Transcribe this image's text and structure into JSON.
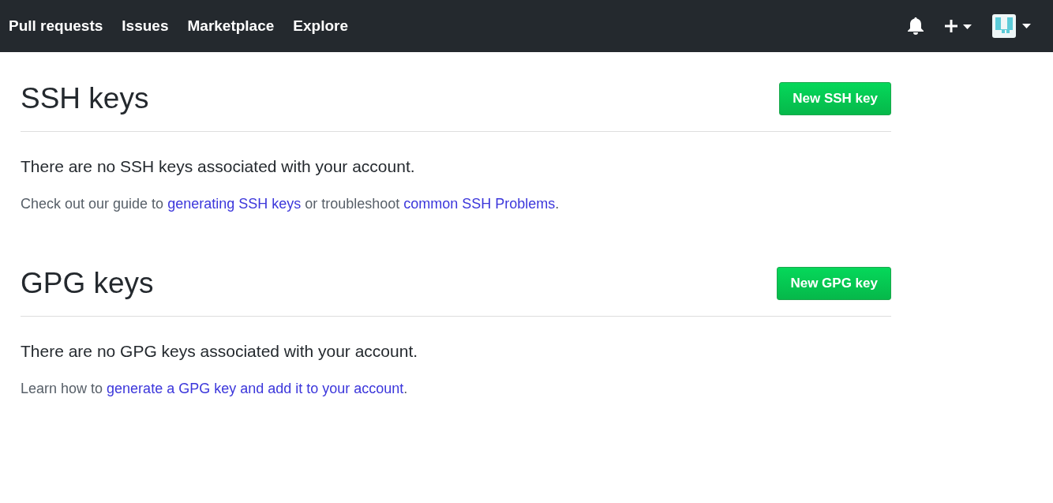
{
  "nav": {
    "links": [
      "Pull requests",
      "Issues",
      "Marketplace",
      "Explore"
    ]
  },
  "sections": [
    {
      "title": "SSH keys",
      "button": "New SSH key",
      "empty": "There are no SSH keys associated with your account.",
      "help": [
        {
          "kind": "text",
          "text": "Check out our guide to "
        },
        {
          "kind": "link",
          "text": "generating SSH keys"
        },
        {
          "kind": "text",
          "text": " or troubleshoot "
        },
        {
          "kind": "link",
          "text": "common SSH Problems"
        },
        {
          "kind": "text",
          "text": "."
        }
      ]
    },
    {
      "title": "GPG keys",
      "button": "New GPG key",
      "empty": "There are no GPG keys associated with your account.",
      "help": [
        {
          "kind": "text",
          "text": "Learn how to "
        },
        {
          "kind": "link",
          "text": "generate a GPG key and add it to your account"
        },
        {
          "kind": "text",
          "text": "."
        }
      ]
    }
  ]
}
